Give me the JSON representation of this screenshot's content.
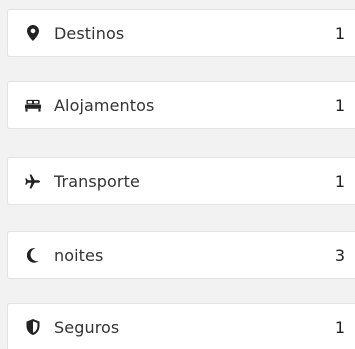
{
  "summary": {
    "items": [
      {
        "icon": "map-marker-icon",
        "label": "Destinos",
        "count": "1"
      },
      {
        "icon": "bed-icon",
        "label": "Alojamentos",
        "count": "1"
      },
      {
        "icon": "airplane-icon",
        "label": "Transporte",
        "count": "1"
      },
      {
        "icon": "moon-icon",
        "label": "noites",
        "count": "3"
      },
      {
        "icon": "shield-icon",
        "label": "Seguros",
        "count": "1"
      }
    ]
  },
  "colors": {
    "icon": "#222222",
    "text": "#333333",
    "card_bg": "#ffffff",
    "page_bg": "#f2f2f2",
    "border": "#e3e3e3"
  }
}
